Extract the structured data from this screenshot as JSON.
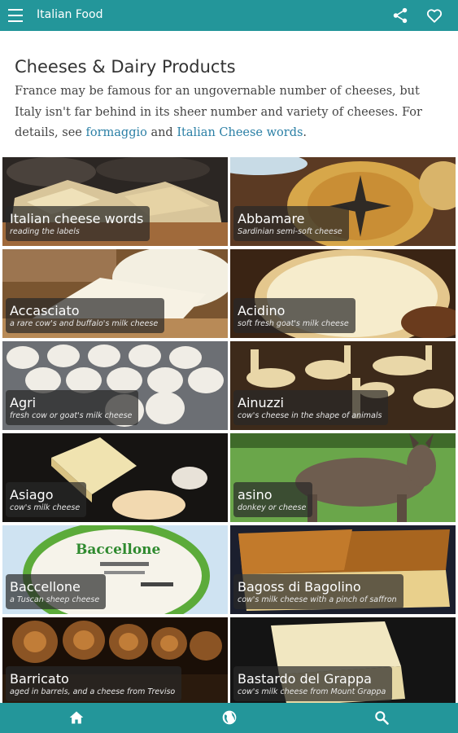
{
  "header": {
    "title": "Italian Food",
    "menu_icon": "hamburger-menu-icon",
    "share_icon": "share-icon",
    "favorite_icon": "heart-icon"
  },
  "page": {
    "title": "Cheeses & Dairy Products",
    "intro_text": "France may be famous for an ungovernable number of cheeses, but Italy isn't far behind in its sheer number and variety of cheeses. For details, see ",
    "link1": "formaggio",
    "and_text": " and ",
    "link2": "Italian Cheese words",
    "end_text": "."
  },
  "tiles": [
    {
      "name": "Italian cheese words",
      "sub": "reading the labels"
    },
    {
      "name": "Abbamare",
      "sub": "Sardinian semi-soft cheese"
    },
    {
      "name": "Accasciato",
      "sub": "a rare cow's and buffalo's milk cheese"
    },
    {
      "name": "Acidino",
      "sub": "soft fresh goat's milk cheese"
    },
    {
      "name": "Agri",
      "sub": "fresh cow or goat's milk cheese"
    },
    {
      "name": "Ainuzzi",
      "sub": "cow's cheese in the shape of animals"
    },
    {
      "name": "Asiago",
      "sub": "cow's milk cheese"
    },
    {
      "name": "asino",
      "sub": "donkey or cheese"
    },
    {
      "name": "Baccellone",
      "sub": "a Tuscan sheep cheese"
    },
    {
      "name": "Bagoss di Bagolino",
      "sub": "cow's milk cheese with a pinch of saffron"
    },
    {
      "name": "Barricato",
      "sub": "aged in barrels, and a cheese from Treviso"
    },
    {
      "name": "Bastardo del Grappa",
      "sub": "cow's milk cheese from Mount Grappa"
    }
  ],
  "photo_text": {
    "baccellone_brand": "Baccellone"
  },
  "bottom_nav": {
    "home_icon": "home-icon",
    "globe_icon": "globe-icon",
    "search_icon": "search-icon"
  },
  "colors": {
    "accent": "#23969a",
    "link": "#2a7fa5"
  }
}
